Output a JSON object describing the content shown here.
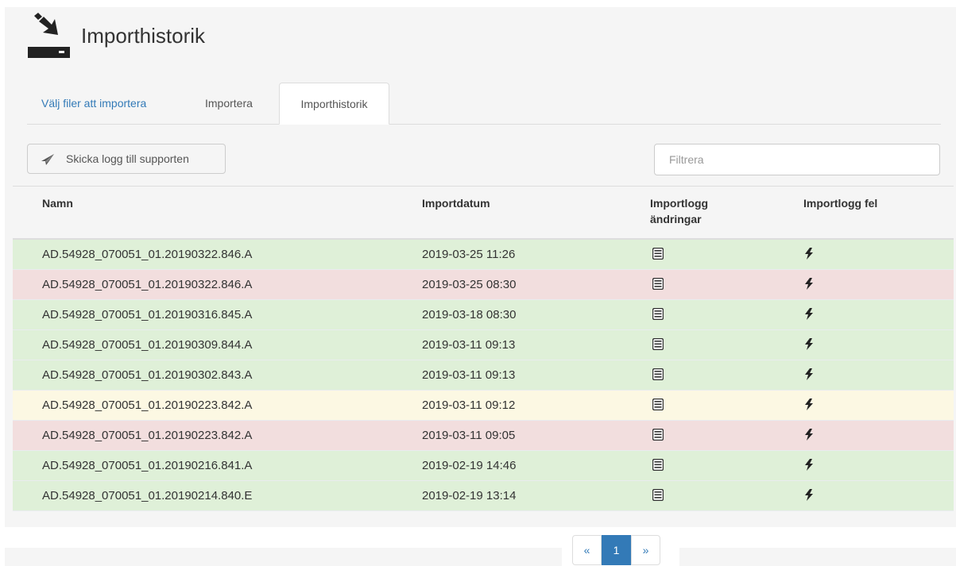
{
  "header": {
    "title": "Importhistorik",
    "icon": "import-tray-icon"
  },
  "tabs": [
    {
      "label": "Välj filer att importera",
      "active": false
    },
    {
      "label": "Importera",
      "active": false
    },
    {
      "label": "Importhistorik",
      "active": true
    }
  ],
  "toolbar": {
    "send_log_label": "Skicka logg till supporten",
    "send_log_icon": "send-icon",
    "filter_placeholder": "Filtrera"
  },
  "table": {
    "headers": {
      "name": "Namn",
      "date": "Importdatum",
      "log_changes_line1": "Importlogg",
      "log_changes_line2": "ändringar",
      "log_errors": "Importlogg fel"
    },
    "rows": [
      {
        "name": "AD.54928_070051_01.20190322.846.A",
        "date": "2019-03-25 11:26",
        "status": "success"
      },
      {
        "name": "AD.54928_070051_01.20190322.846.A",
        "date": "2019-03-25 08:30",
        "status": "danger"
      },
      {
        "name": "AD.54928_070051_01.20190316.845.A",
        "date": "2019-03-18 08:30",
        "status": "success"
      },
      {
        "name": "AD.54928_070051_01.20190309.844.A",
        "date": "2019-03-11 09:13",
        "status": "success"
      },
      {
        "name": "AD.54928_070051_01.20190302.843.A",
        "date": "2019-03-11 09:13",
        "status": "success"
      },
      {
        "name": "AD.54928_070051_01.20190223.842.A",
        "date": "2019-03-11 09:12",
        "status": "warning"
      },
      {
        "name": "AD.54928_070051_01.20190223.842.A",
        "date": "2019-03-11 09:05",
        "status": "danger"
      },
      {
        "name": "AD.54928_070051_01.20190216.841.A",
        "date": "2019-02-19 14:46",
        "status": "success"
      },
      {
        "name": "AD.54928_070051_01.20190214.840.E",
        "date": "2019-02-19 13:14",
        "status": "success"
      }
    ],
    "row_icons": {
      "log_changes": "list-alt-icon",
      "log_errors": "flash-icon"
    }
  },
  "colors": {
    "success": "#dff0d8",
    "danger": "#f2dede",
    "warning": "#fcf8e3",
    "accent": "#337ab7"
  },
  "pagination": {
    "prev": "«",
    "current": "1",
    "next": "»"
  }
}
